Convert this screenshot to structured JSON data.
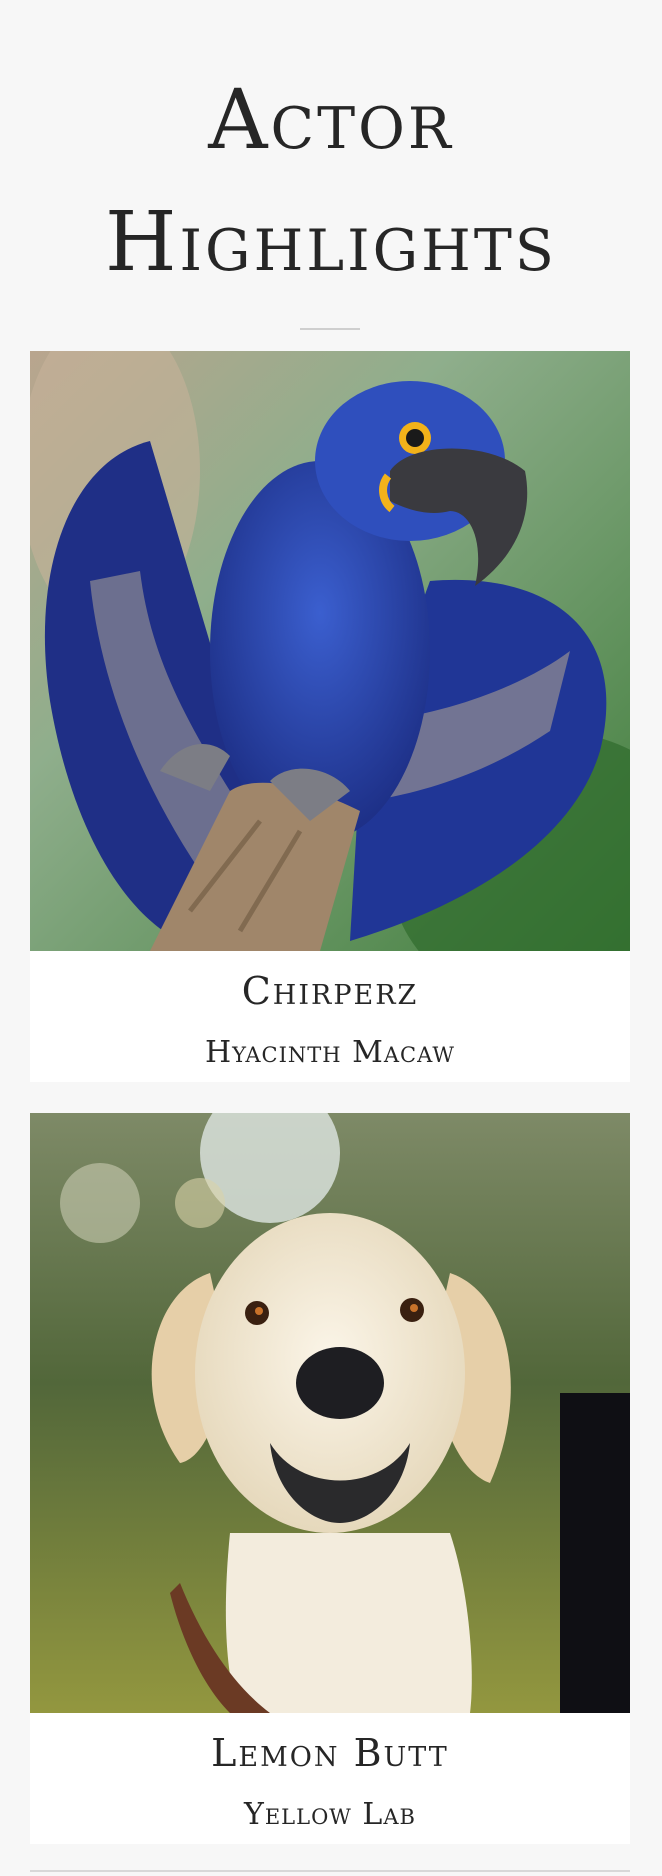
{
  "page": {
    "title_line1": "Actor",
    "title_line2": "Highlights"
  },
  "actors": [
    {
      "name": "Chirperz",
      "species": "Hyacinth Macaw",
      "photo_icon": "macaw-photo"
    },
    {
      "name": "Lemon Butt",
      "species": "Yellow Lab",
      "photo_icon": "labrador-photo"
    }
  ],
  "colors": {
    "background": "#f7f7f7",
    "card": "#ffffff",
    "text": "#262626",
    "macaw_blue": "#2a44a8",
    "lab_cream": "#efe6d2"
  }
}
